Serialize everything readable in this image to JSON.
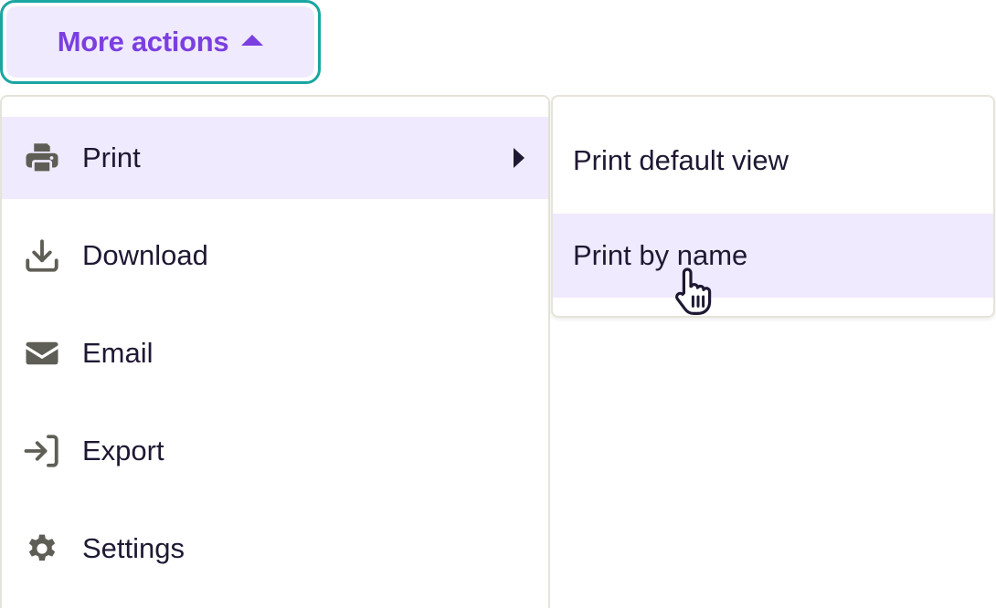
{
  "trigger": {
    "label": "More actions",
    "icon": "caret-up-icon",
    "state": "open"
  },
  "menu": {
    "items": [
      {
        "label": "Print",
        "icon": "printer-icon",
        "has_submenu": true,
        "active": true
      },
      {
        "label": "Download",
        "icon": "download-icon",
        "has_submenu": false,
        "active": false
      },
      {
        "label": "Email",
        "icon": "envelope-icon",
        "has_submenu": false,
        "active": false
      },
      {
        "label": "Export",
        "icon": "export-icon",
        "has_submenu": false,
        "active": false
      },
      {
        "label": "Settings",
        "icon": "gear-icon",
        "has_submenu": false,
        "active": false
      }
    ]
  },
  "submenu": {
    "items": [
      {
        "label": "Print default view",
        "hovered": false
      },
      {
        "label": "Print by name",
        "hovered": true
      }
    ]
  },
  "colors": {
    "accent": "#7b3fe0",
    "focus_ring": "#1aa6a1",
    "highlight_bg": "#efeafd",
    "text": "#1f1833",
    "icon": "#5f5e56",
    "border": "#e6e4da"
  }
}
